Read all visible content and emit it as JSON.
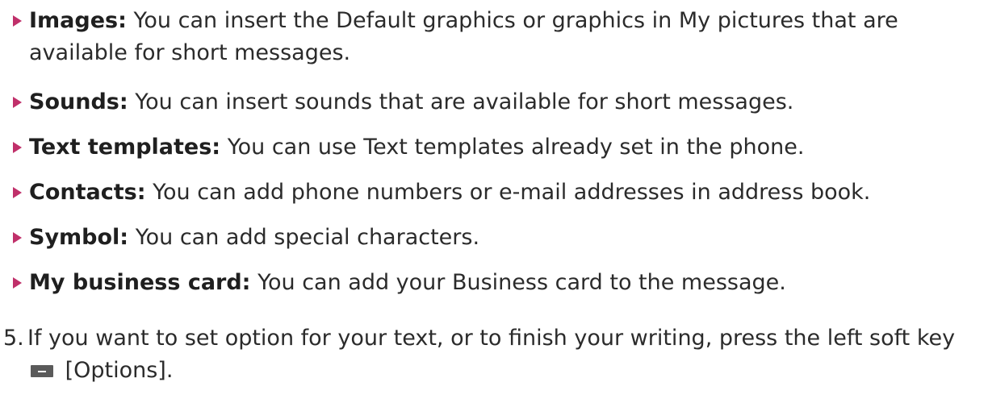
{
  "colors": {
    "bullet_arrow": "#c0306a",
    "text": "#2b2b2b",
    "softkey_icon": "#5a5a5a"
  },
  "bullets": [
    {
      "term": "Images:",
      "text": " You can insert the Default graphics or graphics in My pictures that are available for short messages."
    },
    {
      "term": "Sounds:",
      "text": " You can insert sounds that are available for short messages."
    },
    {
      "term": "Text templates:",
      "text": " You can use Text templates already set in the phone."
    },
    {
      "term": "Contacts:",
      "text": " You can add phone numbers or e-mail addresses in address book."
    },
    {
      "term": "Symbol:",
      "text": " You can add special characters."
    },
    {
      "term": "My business card:",
      "text": " You can add your Business card to the message."
    }
  ],
  "step": {
    "number": "5.",
    "text_before": "If you want to set option for your text, or to finish your writing, press the left soft key",
    "icon": "left-soft-key-icon",
    "text_after": "[Options]."
  }
}
